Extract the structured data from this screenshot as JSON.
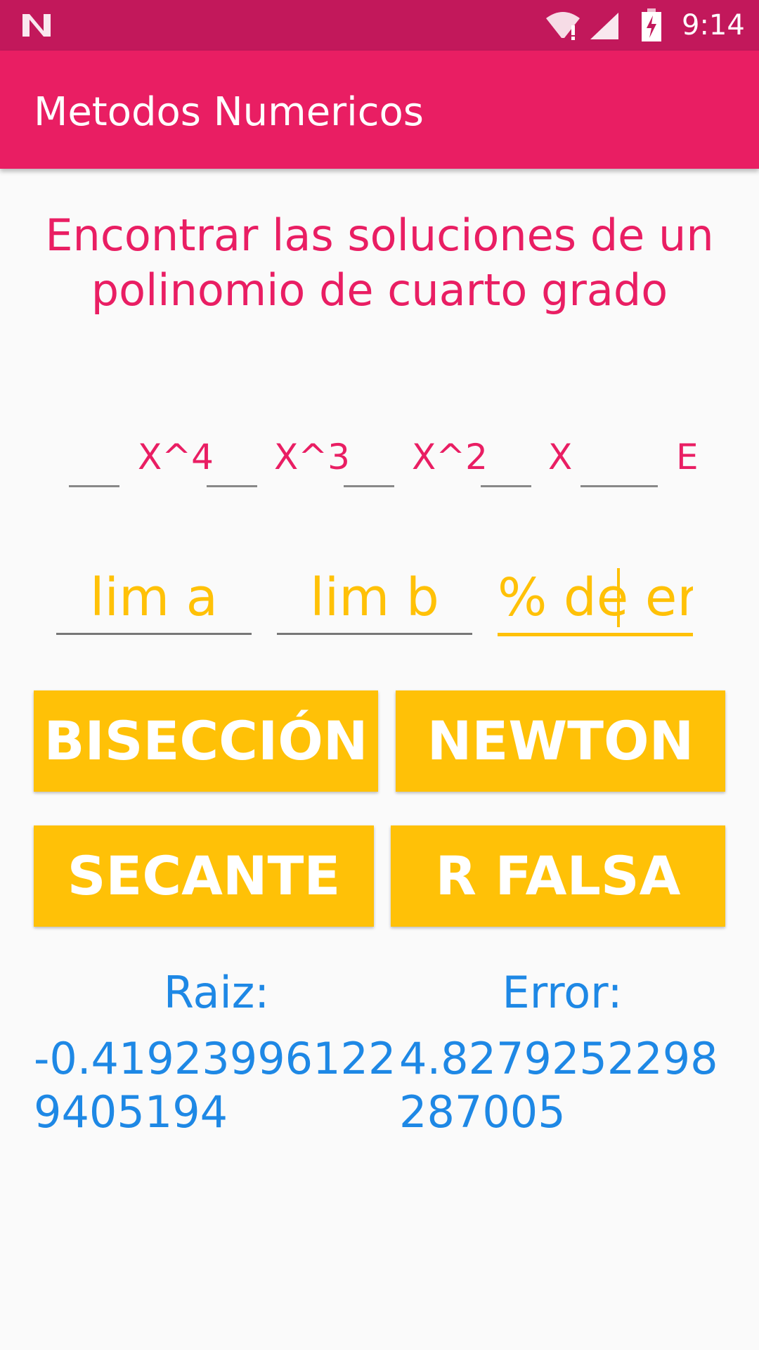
{
  "status_bar": {
    "time": "9:14",
    "icons": [
      "n-logo-icon",
      "wifi-icon",
      "signal-icon",
      "battery-icon"
    ]
  },
  "app_bar": {
    "title": "Metodos Numericos"
  },
  "heading": "Encontrar las soluciones de un polinomio de cuarto grado",
  "polynomial": {
    "terms": [
      "X^4",
      "X^3",
      "X^2",
      "X",
      "E"
    ]
  },
  "limits": {
    "a_hint": "lim a",
    "b_hint": "lim b",
    "error_hint": "% de error"
  },
  "buttons": {
    "biseccion": "BISECCIÓN",
    "newton": "NEWTON",
    "secante": "SECANTE",
    "r_falsa": "R FALSA"
  },
  "results": {
    "root_label": "Raiz:",
    "root_value": "-0.419239961229405194",
    "error_label": "Error:",
    "error_value": "4.8279252298287005"
  },
  "colors": {
    "status_bar": "#c2185b",
    "app_bar": "#e91e63",
    "accent": "#ffc107",
    "result_text": "#1e88e5"
  }
}
